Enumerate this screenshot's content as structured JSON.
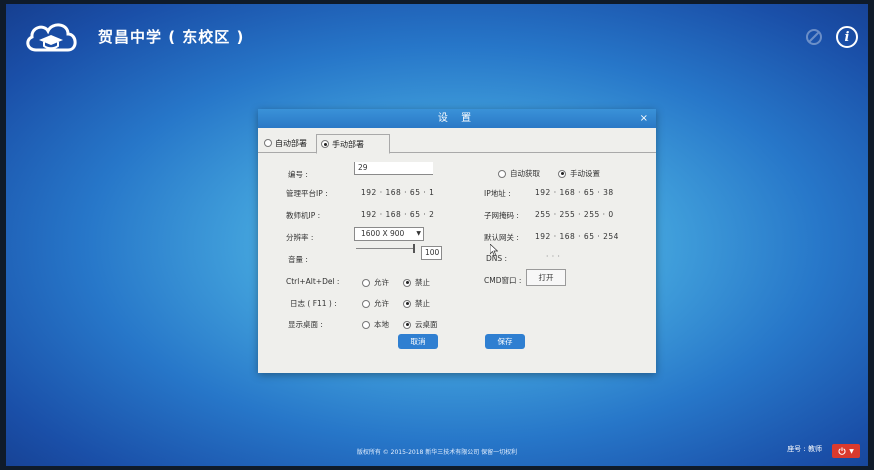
{
  "header": {
    "school_name": "贺昌中学 ( 东校区 )"
  },
  "dialog": {
    "title": "设 置",
    "close": "×",
    "tabs": [
      {
        "label": "自动部署",
        "selected": false
      },
      {
        "label": "手动部署",
        "selected": true
      }
    ],
    "left": {
      "number_label": "编号 :",
      "number_value": "29",
      "mgmt_ip_label": "管理平台IP :",
      "mgmt_ip_value": "192 · 168 · 65 · 1",
      "teacher_ip_label": "教师机IP :",
      "teacher_ip_value": "192 · 168 · 65 · 2",
      "resolution_label": "分辨率 :",
      "resolution_value": "1600 X 900",
      "volume_label": "音量 :",
      "volume_value": "100",
      "volume_level": 1.0,
      "ctrl_alt_del_label": "Ctrl+Alt+Del :",
      "ctrl_alt_del_opts": [
        {
          "label": "允许",
          "selected": false
        },
        {
          "label": "禁止",
          "selected": true
        }
      ],
      "log_label": "日志 ( F11 ) :",
      "log_opts": [
        {
          "label": "允许",
          "selected": false
        },
        {
          "label": "禁止",
          "selected": true
        }
      ],
      "desktop_label": "显示桌面 :",
      "desktop_opts": [
        {
          "label": "本地",
          "selected": false
        },
        {
          "label": "云桌面",
          "selected": true
        }
      ]
    },
    "right": {
      "ip_mode_opts": [
        {
          "label": "自动获取",
          "selected": false
        },
        {
          "label": "手动设置",
          "selected": true
        }
      ],
      "ip_label": "IP地址 :",
      "ip_value": "192 · 168 · 65 · 38",
      "mask_label": "子网掩码 :",
      "mask_value": "255 · 255 · 255 · 0",
      "gateway_label": "默认网关 :",
      "gateway_value": "192 · 168 · 65 · 254",
      "dns_label": "DNS :",
      "dns_value": "·    ·    ·",
      "cmd_label": "CMD窗口 :",
      "cmd_button": "打开"
    },
    "cancel_button": "取消",
    "save_button": "保存"
  },
  "footer": {
    "copyright": "版权所有 © 2015-2018 新华三技术有限公司 保留一切权利"
  },
  "status": {
    "seat": "座号 : 教师"
  },
  "colors": {
    "title_bar": "#2a78c6",
    "button_blue": "#2f7fd1",
    "power_red": "#d93a2e"
  },
  "icons": [
    "cloud-logo-icon",
    "faded-tool-icon",
    "info-icon",
    "power-icon",
    "chevron-down-icon"
  ]
}
